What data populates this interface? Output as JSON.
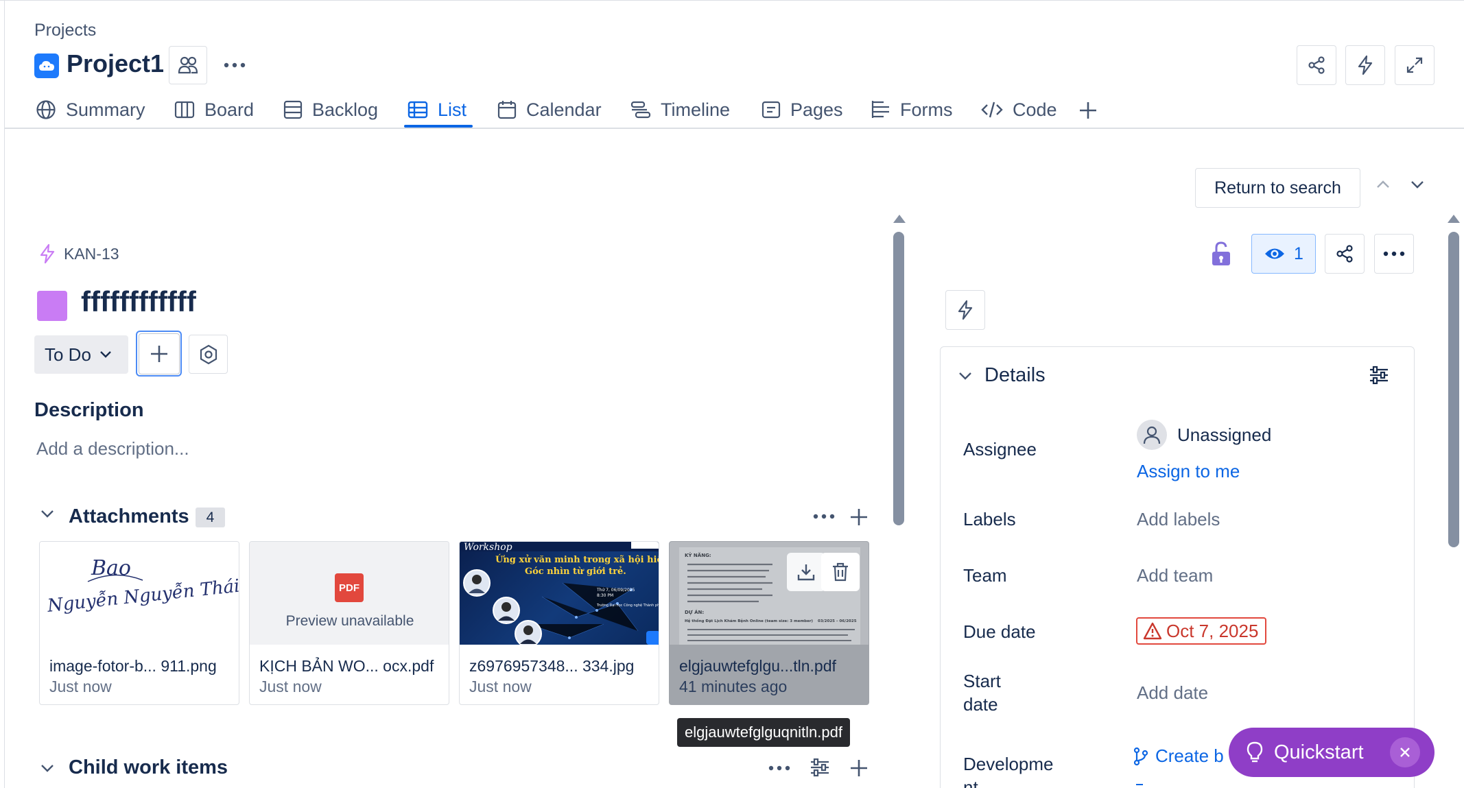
{
  "breadcrumb": "Projects",
  "project": {
    "name": "Project1"
  },
  "tabs": [
    {
      "label": "Summary",
      "icon": "globe-icon"
    },
    {
      "label": "Board",
      "icon": "board-icon"
    },
    {
      "label": "Backlog",
      "icon": "backlog-icon"
    },
    {
      "label": "List",
      "icon": "list-icon",
      "active": true
    },
    {
      "label": "Calendar",
      "icon": "calendar-icon"
    },
    {
      "label": "Timeline",
      "icon": "timeline-icon"
    },
    {
      "label": "Pages",
      "icon": "pages-icon"
    },
    {
      "label": "Forms",
      "icon": "forms-icon"
    },
    {
      "label": "Code",
      "icon": "code-icon"
    }
  ],
  "return_to_search": "Return to search",
  "issue": {
    "key": "KAN-13",
    "title": "ffffffffffff",
    "status": "To Do",
    "description_heading": "Description",
    "description_placeholder": "Add a description..."
  },
  "attachments": {
    "heading": "Attachments",
    "count": "4",
    "items": [
      {
        "name": "image-fotor-b... 911.png",
        "time": "Just now"
      },
      {
        "name": "KỊCH BẢN WO... ocx.pdf",
        "time": "Just now",
        "preview": "Preview unavailable",
        "badge": "PDF"
      },
      {
        "name": "z6976957348... 334.jpg",
        "time": "Just now"
      },
      {
        "name": "elgjauwtefglgu...tln.pdf",
        "time": "41 minutes ago"
      }
    ],
    "tooltip": "elgjauwtefglguqnitln.pdf",
    "signature_lines": [
      "Bao",
      "Nguyễn Nguyễn Thái Bảo"
    ],
    "workshop_thumb": {
      "tag": "Workshop",
      "title": "Ứng xử văn minh trong xã hội hiện đại –",
      "subtitle": "Góc nhìn từ giới trẻ.",
      "date": "Thứ 7, 06/09/2025",
      "time": "8:30 PM",
      "place": "Trường Đại học Công nghệ Thành phố Hồ Chí Minh"
    },
    "pdf_thumb": {
      "section1": "KỸ NĂNG:",
      "section2": "DỰ ÁN:",
      "project_line": "Hệ thống Đặt Lịch Khám Bệnh Online (team size: 3 member)",
      "project_period": "03/2025 – 06/2025"
    }
  },
  "child_items": {
    "heading": "Child work items"
  },
  "watchers": "1",
  "details": {
    "heading": "Details",
    "fields": {
      "assignee_label": "Assignee",
      "assignee_value": "Unassigned",
      "assign_to_me": "Assign to me",
      "labels_label": "Labels",
      "labels_value": "Add labels",
      "team_label": "Team",
      "team_value": "Add team",
      "due_label": "Due date",
      "due_value": "Oct 7, 2025",
      "start_label_1": "Start",
      "start_label_2": "date",
      "start_value": "Add date",
      "dev_label_1": "Developme",
      "dev_label_2": "nt",
      "dev_value": "Create b"
    }
  },
  "quickstart": {
    "label": "Quickstart"
  },
  "colors": {
    "accent": "#0c66e4",
    "issue_type": "#c97cf4",
    "quickstart": "#8f3ec7",
    "overdue": "#c9372c",
    "lock": "#8270db"
  }
}
